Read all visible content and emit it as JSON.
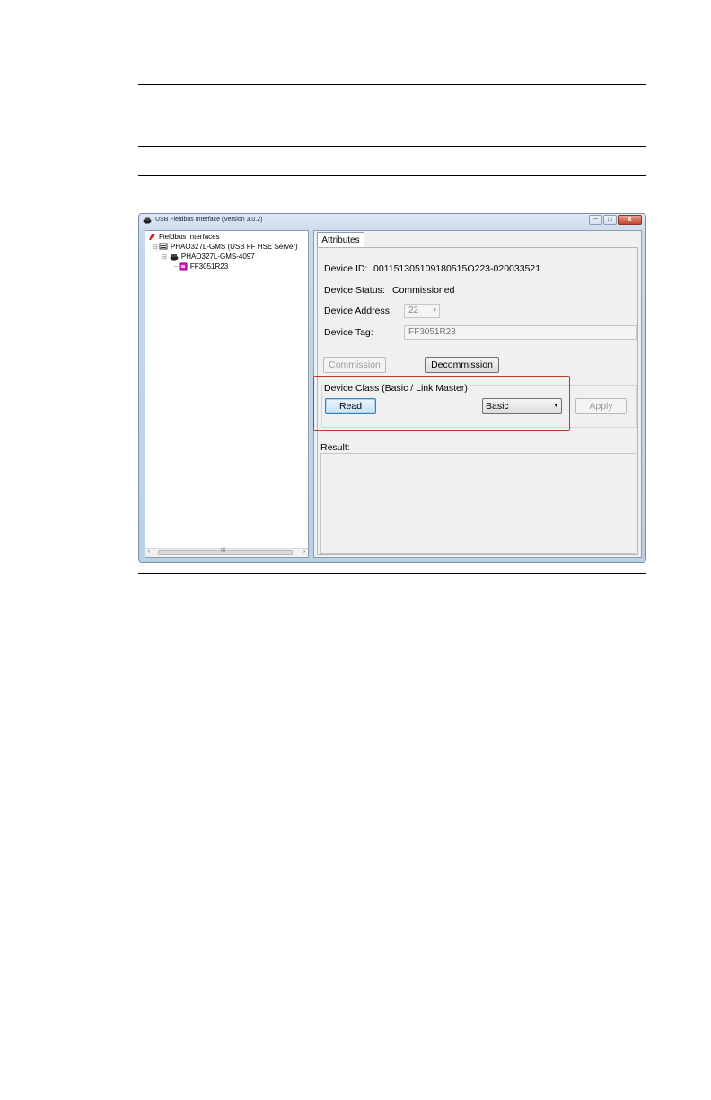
{
  "window": {
    "title": "USB Fieldbus Interface (Version 3.0.2)",
    "controls": {
      "minimize": "–",
      "maximize": "□",
      "close": "x"
    }
  },
  "tree": {
    "items": [
      {
        "label": "Fieldbus Interfaces",
        "icon": "fieldbus-root-icon",
        "level": 0
      },
      {
        "label": "PHAO327L-GMS (USB FF HSE Server)",
        "icon": "server-icon",
        "level": 1
      },
      {
        "label": "PHAO327L-GMS-4097",
        "icon": "network-icon",
        "level": 2
      },
      {
        "label": "FF3051R23",
        "icon": "device-icon",
        "level": 3
      }
    ],
    "scroll_left": "‹",
    "scroll_right": "›",
    "scroll_grip": "III"
  },
  "tabs": {
    "attributes": "Attributes"
  },
  "attributes": {
    "device_id_label": "Device ID:",
    "device_id_value": "001151305109180515O223-020033521",
    "device_status_label": "Device Status:",
    "device_status_value": "Commissioned",
    "device_address_label": "Device Address:",
    "device_address_value": "22",
    "device_tag_label": "Device Tag:",
    "device_tag_value": "FF3051R23",
    "commission_button": "Commission",
    "decommission_button": "Decommission"
  },
  "device_class": {
    "label": "Device Class (Basic / Link Master)",
    "read_button": "Read",
    "selected": "Basic",
    "apply_button": "Apply"
  },
  "result": {
    "label": "Result:"
  },
  "colors": {
    "highlight": "#c0392b",
    "header_rule": "#5a7fa8"
  }
}
